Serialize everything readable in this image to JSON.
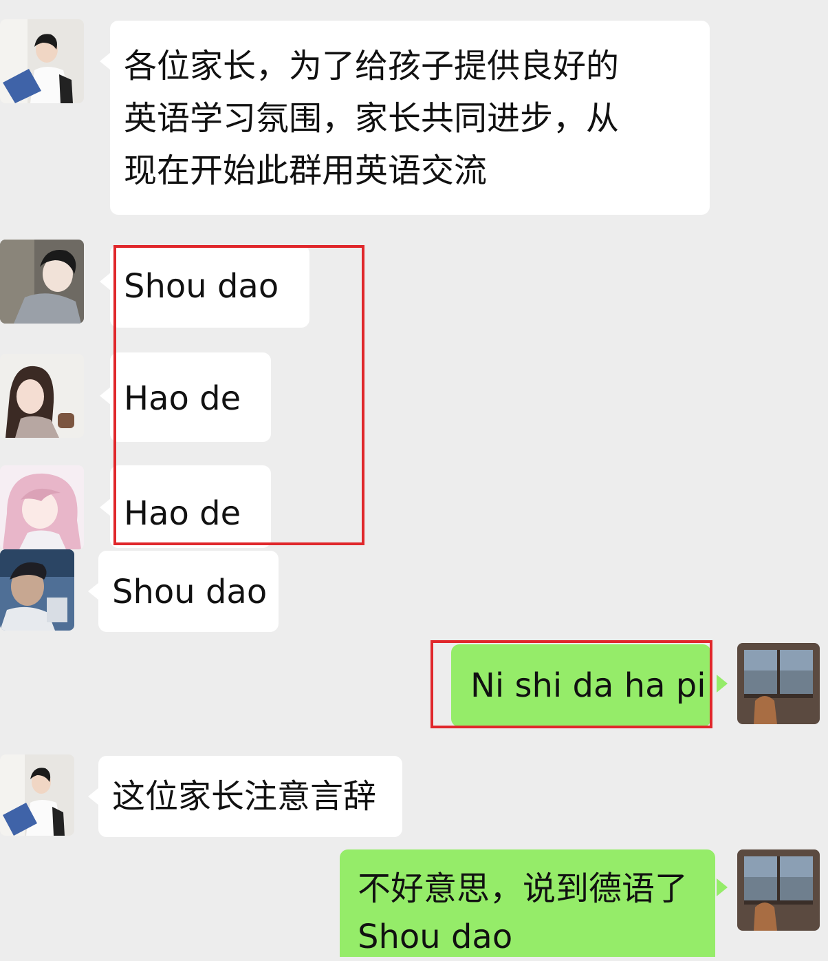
{
  "messages": [
    {
      "sender": "teacher",
      "side": "left",
      "lines": [
        "各位家长，为了给孩子提供良好的",
        "英语学习氛围，家长共同进步，从",
        "现在开始此群用英语交流"
      ]
    },
    {
      "sender": "parent-1",
      "side": "left",
      "text": "Shou dao",
      "highlighted": true
    },
    {
      "sender": "parent-2",
      "side": "left",
      "text": "Hao de",
      "highlighted": true
    },
    {
      "sender": "parent-3",
      "side": "left",
      "text": "Hao de",
      "highlighted": true
    },
    {
      "sender": "parent-4",
      "side": "left",
      "text": "Shou dao"
    },
    {
      "sender": "me",
      "side": "right",
      "text": "Ni shi da ha pi",
      "highlighted": true
    },
    {
      "sender": "teacher",
      "side": "left",
      "text": "这位家长注意言辞"
    },
    {
      "sender": "me",
      "side": "right",
      "lines": [
        "不好意思，说到德语了",
        "Shou dao"
      ]
    }
  ],
  "colors": {
    "background": "#ededed",
    "incoming_bubble": "#ffffff",
    "outgoing_bubble": "#95ec69",
    "highlight": "#e0272b"
  },
  "icons": {
    "avatar_teacher": "woman-with-laptop-photo",
    "avatar_parent_1": "man-portrait-photo",
    "avatar_parent_2": "girl-cartoon-avatar",
    "avatar_parent_3": "anime-pink-hair-avatar",
    "avatar_parent_4": "man-selfie-photo",
    "avatar_me": "window-city-view-photo"
  }
}
